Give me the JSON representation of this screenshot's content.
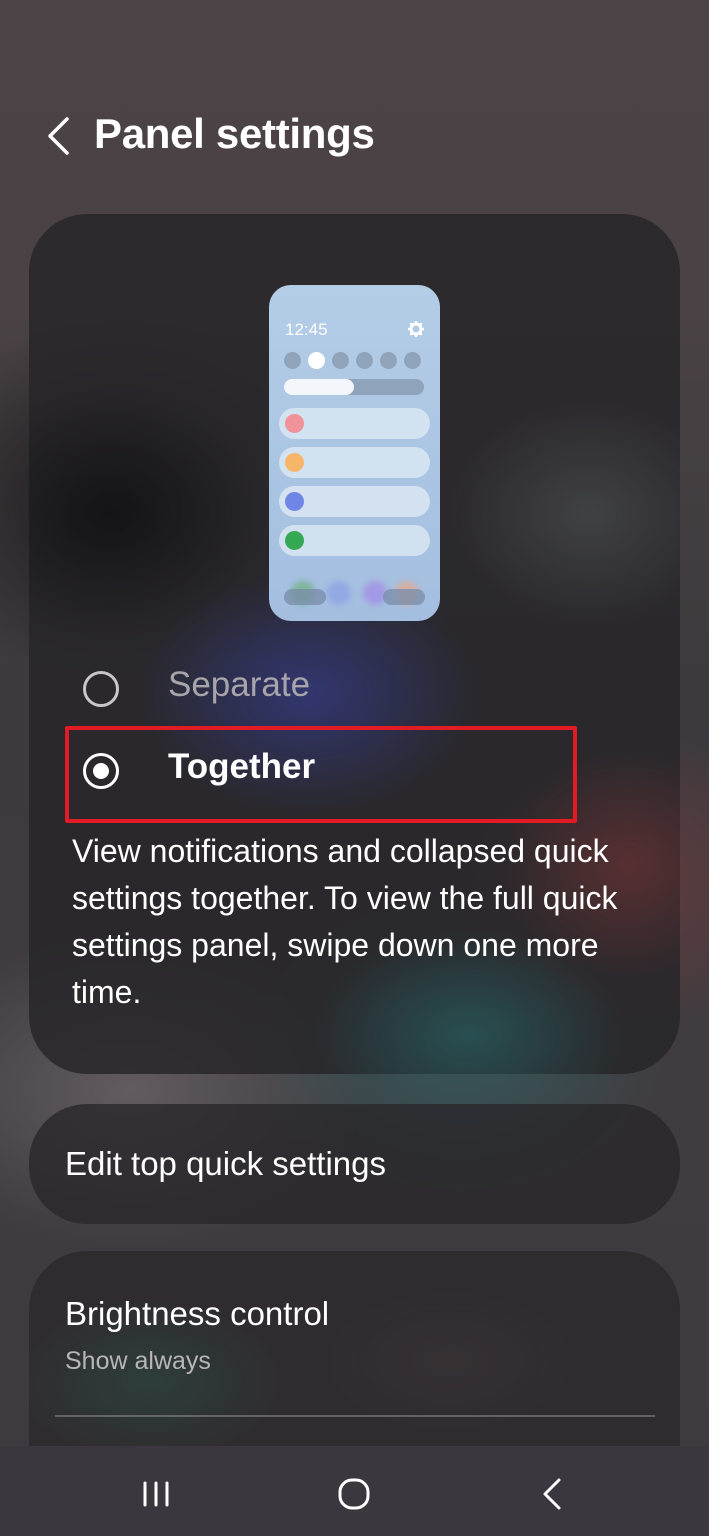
{
  "header": {
    "title": "Panel settings",
    "back_icon": "chevron-left-icon"
  },
  "preview": {
    "time": "12:45",
    "gear_icon": "gear-icon",
    "brightness_level": 0.5,
    "notification_colors": [
      "#f0929a",
      "#f7b56a",
      "#6f86e6",
      "#35a853"
    ]
  },
  "options": {
    "separate_label": "Separate",
    "together_label": "Together",
    "selected": "Together",
    "description": "View notifications and collapsed quick settings together. To view the full quick settings panel, swipe down one more time."
  },
  "rows": {
    "edit_top_quick_settings": "Edit top quick settings",
    "brightness_control": "Brightness control",
    "brightness_control_value": "Show always"
  },
  "nav": {
    "recents_icon": "recents-icon",
    "home_icon": "home-icon",
    "back_icon": "back-icon"
  },
  "colors": {
    "highlight": "#e21b24",
    "preview_bg": "#b4cde7"
  }
}
